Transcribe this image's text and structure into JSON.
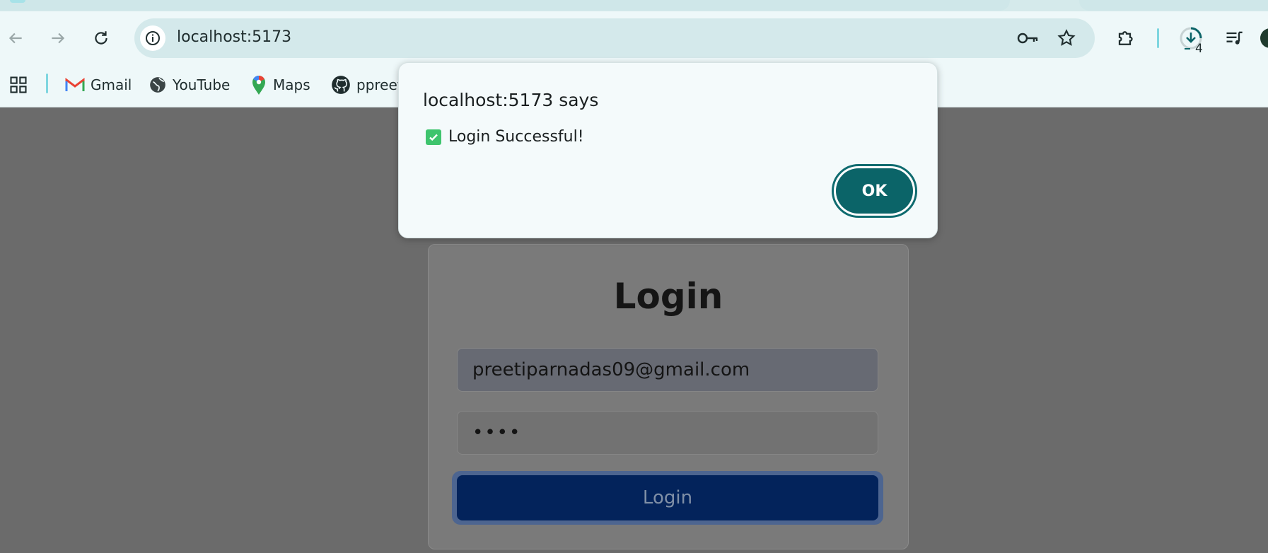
{
  "browser": {
    "url": "localhost:5173",
    "download_badge": "4",
    "bookmarks": [
      {
        "label": "Gmail",
        "icon": "gmail-icon"
      },
      {
        "label": "YouTube",
        "icon": "globe-icon"
      },
      {
        "label": "Maps",
        "icon": "maps-icon"
      },
      {
        "label": "ppreet",
        "icon": "github-icon"
      }
    ],
    "accent_color": "#7fd6e0"
  },
  "page": {
    "title": "Login",
    "email_value": "preetiparnadas09@gmail.com",
    "password_value": "••••",
    "login_button": "Login"
  },
  "dialog": {
    "title": "localhost:5173 says",
    "message": "Login Successful!",
    "message_icon": "check-box-icon",
    "ok_label": "OK",
    "button_color": "#0b6468"
  }
}
